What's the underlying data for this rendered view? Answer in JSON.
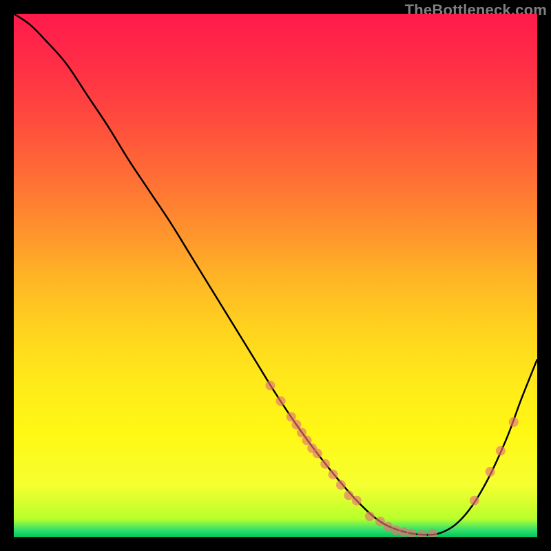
{
  "watermark": "TheBottleneck.com",
  "chart_data": {
    "type": "line",
    "title": "",
    "xlabel": "",
    "ylabel": "",
    "xlim": [
      0,
      100
    ],
    "ylim": [
      0,
      100
    ],
    "gradient_stops": [
      {
        "offset": 0.0,
        "color": "#ff1a4b"
      },
      {
        "offset": 0.1,
        "color": "#ff2f46"
      },
      {
        "offset": 0.2,
        "color": "#ff4a3e"
      },
      {
        "offset": 0.3,
        "color": "#ff6a36"
      },
      {
        "offset": 0.4,
        "color": "#ff8d2e"
      },
      {
        "offset": 0.5,
        "color": "#ffb326"
      },
      {
        "offset": 0.6,
        "color": "#ffd21e"
      },
      {
        "offset": 0.7,
        "color": "#ffe91a"
      },
      {
        "offset": 0.8,
        "color": "#fff814"
      },
      {
        "offset": 0.9,
        "color": "#f6ff30"
      },
      {
        "offset": 0.965,
        "color": "#b8ff2c"
      },
      {
        "offset": 0.985,
        "color": "#38e26b"
      },
      {
        "offset": 1.0,
        "color": "#00c65e"
      }
    ],
    "series": [
      {
        "name": "bottleneck-curve",
        "x": [
          0.0,
          3.0,
          6.0,
          10.0,
          14.0,
          18.0,
          22.0,
          26.0,
          30.0,
          34.0,
          38.0,
          42.0,
          46.0,
          50.0,
          54.0,
          58.0,
          62.0,
          66.0,
          70.0,
          74.0,
          78.0,
          82.0,
          86.0,
          90.0,
          94.0,
          97.0,
          100.0
        ],
        "y": [
          100.0,
          98.0,
          95.0,
          90.5,
          84.5,
          78.5,
          72.0,
          66.0,
          60.0,
          53.5,
          47.0,
          40.5,
          34.0,
          27.5,
          21.5,
          16.0,
          11.0,
          6.5,
          3.0,
          1.2,
          0.5,
          1.0,
          4.0,
          10.0,
          18.5,
          26.5,
          34.0
        ]
      }
    ],
    "markers": {
      "color": "#e57373",
      "radius": 7,
      "points": [
        {
          "x": 49.0,
          "y": 29.0
        },
        {
          "x": 51.0,
          "y": 26.0
        },
        {
          "x": 53.0,
          "y": 23.0
        },
        {
          "x": 54.0,
          "y": 21.5
        },
        {
          "x": 55.0,
          "y": 20.0
        },
        {
          "x": 56.0,
          "y": 18.5
        },
        {
          "x": 57.0,
          "y": 17.0
        },
        {
          "x": 58.0,
          "y": 16.0
        },
        {
          "x": 59.5,
          "y": 14.0
        },
        {
          "x": 61.0,
          "y": 12.0
        },
        {
          "x": 62.5,
          "y": 10.0
        },
        {
          "x": 64.0,
          "y": 8.0
        },
        {
          "x": 65.5,
          "y": 7.0
        },
        {
          "x": 68.0,
          "y": 4.0
        },
        {
          "x": 70.0,
          "y": 3.0
        },
        {
          "x": 71.5,
          "y": 2.0
        },
        {
          "x": 73.0,
          "y": 1.3
        },
        {
          "x": 74.5,
          "y": 1.0
        },
        {
          "x": 76.0,
          "y": 0.7
        },
        {
          "x": 78.0,
          "y": 0.5
        },
        {
          "x": 80.0,
          "y": 0.7
        },
        {
          "x": 88.0,
          "y": 7.0
        },
        {
          "x": 91.0,
          "y": 12.5
        },
        {
          "x": 93.0,
          "y": 16.5
        },
        {
          "x": 95.5,
          "y": 22.0
        }
      ]
    }
  }
}
